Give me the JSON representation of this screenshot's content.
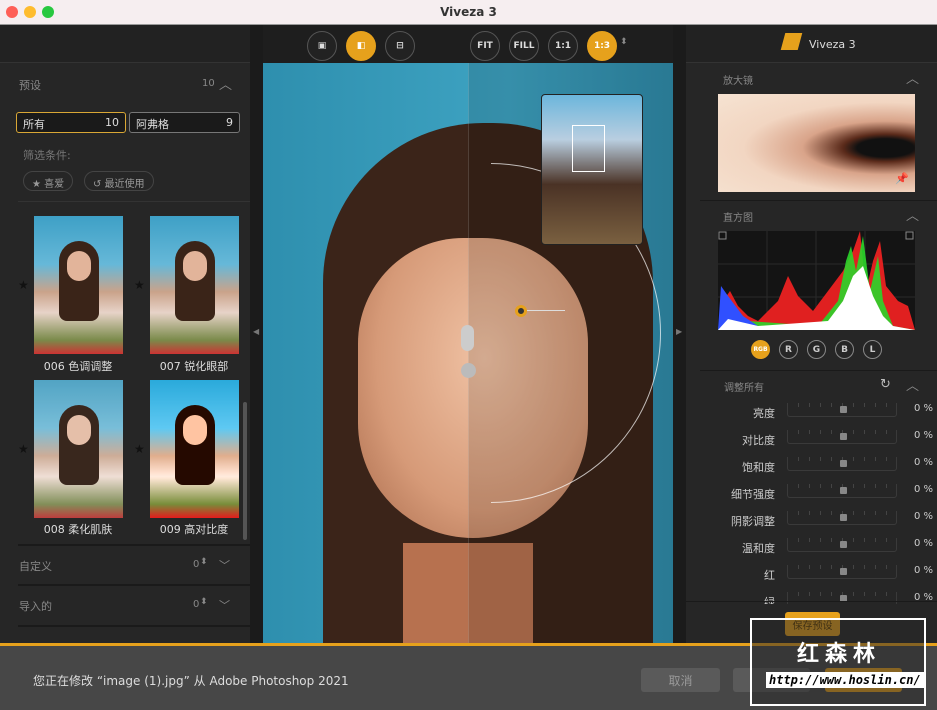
{
  "window": {
    "title": "Viveza 3"
  },
  "left": {
    "presets_title": "预设",
    "presets_count": "10",
    "filters": [
      {
        "label": "所有",
        "count": "10"
      },
      {
        "label": "阿弗格",
        "count": "9"
      }
    ],
    "filter_label": "筛选条件:",
    "chips": [
      {
        "icon": "star-icon",
        "label": "★ 喜爱"
      },
      {
        "icon": "recent-icon",
        "label": "↺ 最近使用"
      }
    ],
    "thumbnails": [
      {
        "label": "006 色调调整"
      },
      {
        "label": "007 锐化眼部"
      },
      {
        "label": "008 柔化肌肤"
      },
      {
        "label": "009 高对比度"
      }
    ],
    "custom_title": "自定义",
    "custom_count": "0",
    "imported_title": "导入的",
    "imported_count": "0"
  },
  "toolbar": {
    "views": [
      "single-view-icon",
      "split-view-icon",
      "side-by-side-icon"
    ],
    "zoom": [
      "FIT",
      "FILL",
      "1:1",
      "1:3"
    ],
    "active_zoom": "1:3"
  },
  "right": {
    "logo": "Viveza 3",
    "loupe_title": "放大镜",
    "histogram_title": "直方图",
    "channels": [
      "RGB",
      "R",
      "G",
      "B",
      "L"
    ],
    "active_channel": "RGB",
    "adjust_title": "调整所有",
    "sliders": [
      {
        "label": "亮度",
        "value": "0 %"
      },
      {
        "label": "对比度",
        "value": "0 %"
      },
      {
        "label": "饱和度",
        "value": "0 %"
      },
      {
        "label": "细节强度",
        "value": "0 %"
      },
      {
        "label": "阴影调整",
        "value": "0 %"
      },
      {
        "label": "温和度",
        "value": "0 %"
      },
      {
        "label": "红",
        "value": "0 %"
      },
      {
        "label": "绿",
        "value": "0 %"
      }
    ],
    "save_preset": "保存预设"
  },
  "bottom": {
    "status": "您正在修改 “image (1).jpg” 从 Adobe Photoshop 2021",
    "cancel": "取消"
  },
  "watermark": {
    "title": "红森林",
    "url": "http://www.hoslin.cn/"
  },
  "colors": {
    "accent": "#e6a11c"
  }
}
